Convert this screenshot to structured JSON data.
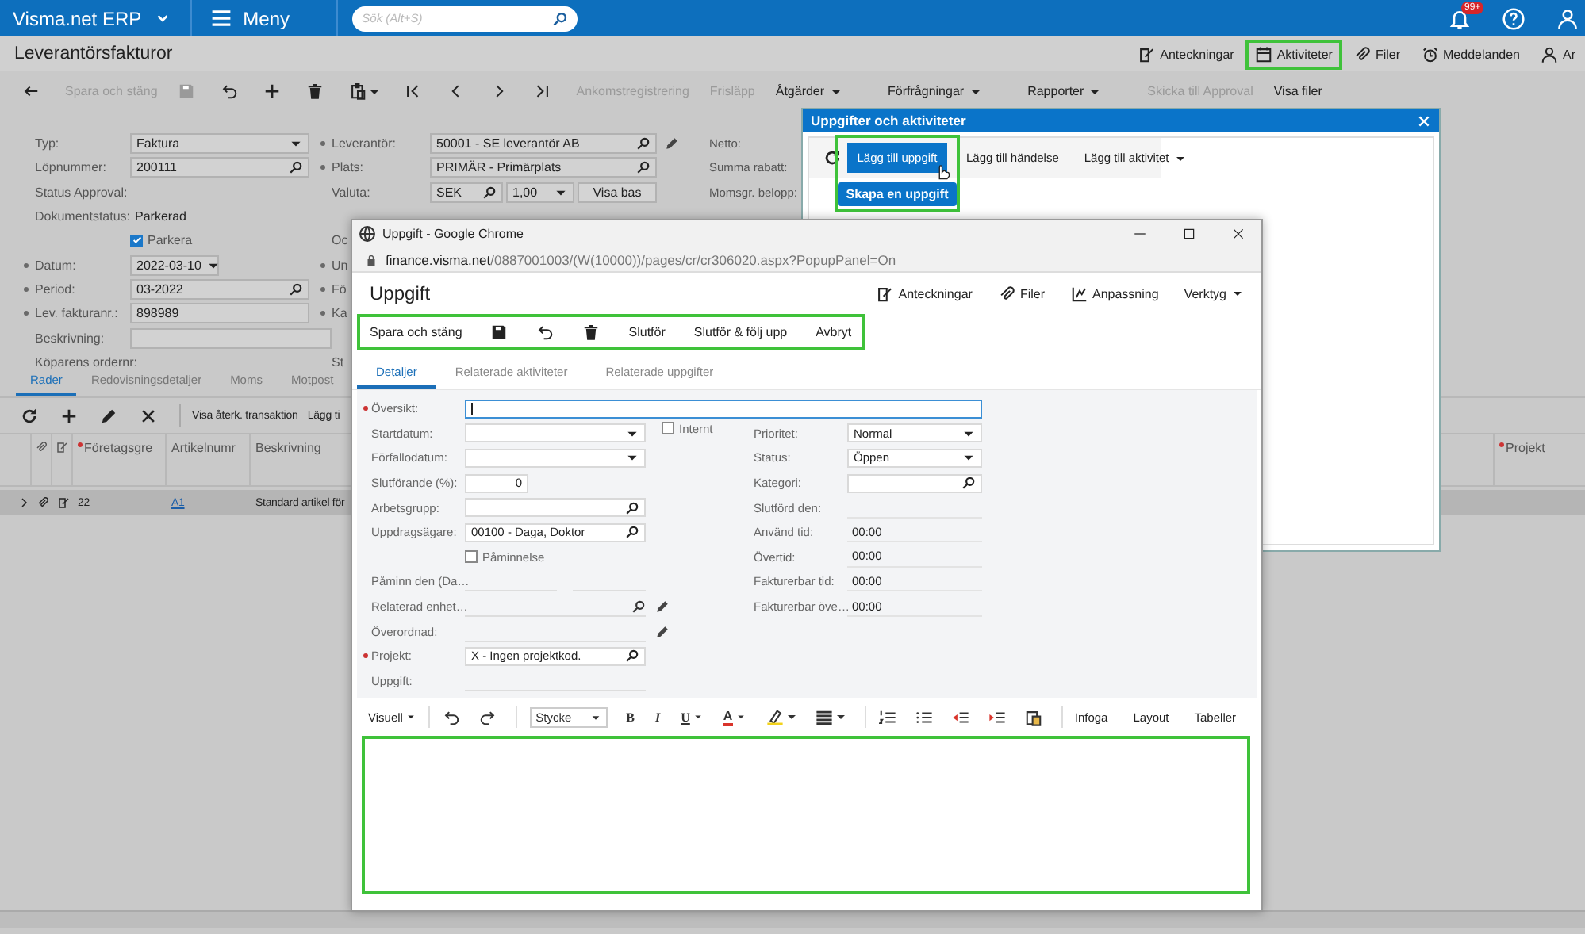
{
  "topbar": {
    "app_name": "Visma.net ERP",
    "menu_label": "Meny",
    "search": {
      "placeholder": "Sök (Alt+S)"
    },
    "notification_badge": "99+"
  },
  "page": {
    "title": "Leverantörsfakturor",
    "header_actions": [
      {
        "label": "Anteckningar",
        "highlighted": false
      },
      {
        "label": "Aktiviteter",
        "highlighted": true
      },
      {
        "label": "Filer",
        "highlighted": false
      },
      {
        "label": "Meddelanden",
        "highlighted": false
      },
      {
        "label": "Ar",
        "highlighted": false
      }
    ]
  },
  "toolbar": {
    "save_and_close": {
      "label": "Spara och stäng",
      "disabled": true
    },
    "save_disabled": true,
    "actions": [
      {
        "label": "Ankomstregistrering",
        "disabled": true,
        "dropdown": false
      },
      {
        "label": "Frisläpp",
        "disabled": true,
        "dropdown": false
      },
      {
        "label": "Åtgärder",
        "disabled": false,
        "dropdown": true
      },
      {
        "label": "Förfrågningar",
        "disabled": false,
        "dropdown": true
      },
      {
        "label": "Rapporter",
        "disabled": false,
        "dropdown": true
      },
      {
        "label": "Skicka till Approval",
        "disabled": true,
        "dropdown": false
      },
      {
        "label": "Visa filer",
        "disabled": false,
        "dropdown": false
      }
    ]
  },
  "form": {
    "rows": [
      {
        "left": {
          "label": "Typ:",
          "required": false,
          "kind": "select",
          "value": "Faktura"
        },
        "mid": {
          "label": "Leverantör:",
          "required": true,
          "kind": "lookup",
          "value": "50001 - SE leverantör AB",
          "editable": true
        },
        "right": {
          "label": "Netto:"
        }
      },
      {
        "left": {
          "label": "Löpnummer:",
          "required": false,
          "kind": "lookup",
          "value": "200111"
        },
        "mid": {
          "label": "Plats:",
          "required": true,
          "kind": "lookup",
          "value": "PRIMÄR - Primärplats",
          "editable": false
        },
        "right": {
          "label": "Summa rabatt:"
        }
      },
      {
        "left": {
          "label": "Status Approval:",
          "required": false,
          "kind": "none"
        },
        "mid": {
          "label": "Valuta:",
          "required": false,
          "kind": "currency",
          "code": "SEK",
          "rate": "1,00",
          "button": "Visa bas",
          "editable": false
        },
        "right": {
          "label": "Momsgr. belopp:"
        }
      },
      {
        "left": {
          "label": "Dokumentstatus:",
          "required": false,
          "kind": "static",
          "value": "Parkerad"
        }
      },
      {
        "left": {
          "kind": "checkbox",
          "label": "Parkera",
          "checked": true
        },
        "mid": {
          "label": "Oc",
          "required": false,
          "kind": "none",
          "editable": false
        }
      },
      {
        "left": {
          "label": "Datum:",
          "required": true,
          "kind": "date",
          "value": "2022-03-10"
        },
        "mid": {
          "label": "Un",
          "required": true,
          "kind": "none",
          "editable": false
        }
      },
      {
        "left": {
          "label": "Period:",
          "required": true,
          "kind": "lookup",
          "value": "03-2022"
        },
        "mid": {
          "label": "Fö",
          "required": true,
          "kind": "none",
          "editable": false
        }
      },
      {
        "left": {
          "label": "Lev. fakturanr.:",
          "required": true,
          "kind": "text",
          "value": "898989"
        },
        "mid": {
          "label": "Ka",
          "required": true,
          "kind": "none",
          "editable": false
        }
      },
      {
        "left": {
          "label": "Beskrivning:",
          "required": false,
          "kind": "wide"
        }
      },
      {
        "left": {
          "label": "Köparens ordernr:",
          "required": false,
          "kind": "none"
        },
        "mid": {
          "label": "St",
          "required": false,
          "kind": "none",
          "editable": false
        }
      }
    ]
  },
  "detail_tabs": [
    {
      "label": "Rader",
      "selected": true
    },
    {
      "label": "Redovisningsdetaljer",
      "selected": false
    },
    {
      "label": "Moms",
      "selected": false
    },
    {
      "label": "Motpost",
      "selected": false
    }
  ],
  "grid": {
    "toolbar": [
      "Visa återk. transaktion",
      "Lägg ti"
    ],
    "columns": [
      {
        "label": "Företagsgre",
        "required": true
      },
      {
        "label": "Artikelnumr",
        "required": false
      },
      {
        "label": "Beskrivning",
        "required": false
      }
    ],
    "far_right_column": {
      "label": "Projekt",
      "required": true
    },
    "rows": [
      {
        "selected": true,
        "cells": [
          {
            "text": "22",
            "kind": "text"
          },
          {
            "text": "A1",
            "kind": "link"
          },
          {
            "text": "Standard artikel för",
            "kind": "text"
          }
        ]
      }
    ]
  },
  "activities_popup": {
    "title": "Uppgifter och aktiviteter",
    "highlighted": true,
    "tooltip": "Skapa en uppgift",
    "buttons": [
      {
        "label": "Lägg till uppgift",
        "kind": "primary"
      },
      {
        "label": "Lägg till händelse",
        "kind": "plain"
      },
      {
        "label": "Lägg till aktivitet",
        "kind": "dropdown"
      }
    ]
  },
  "browser_window": {
    "title": "Uppgift - Google Chrome",
    "url_host": "finance.visma.net",
    "url_path": "/0887001003/(W(10000))/pages/cr/cr306020.aspx?PopupPanel=On",
    "page_title": "Uppgift",
    "header_actions": [
      {
        "label": "Anteckningar",
        "dropdown": false
      },
      {
        "label": "Filer",
        "dropdown": false
      },
      {
        "label": "Anpassning",
        "dropdown": false
      },
      {
        "label": "Verktyg",
        "dropdown": true
      }
    ],
    "toolbar": {
      "highlighted": true,
      "items": [
        "Spara och stäng",
        "Slutför",
        "Slutför & följ upp",
        "Avbryt"
      ]
    },
    "tabs": [
      {
        "label": "Detaljer",
        "selected": true
      },
      {
        "label": "Relaterade aktiviteter",
        "selected": false
      },
      {
        "label": "Relaterade uppgifter",
        "selected": false
      }
    ],
    "overview": {
      "label": "Översikt:",
      "required": true,
      "focused": true
    },
    "rows": [
      {
        "left": {
          "label": "Startdatum:",
          "required": false,
          "kind": "date"
        },
        "extra": {
          "kind": "checkbox",
          "label": "Internt",
          "checked": false
        },
        "right": {
          "label": "Prioritet:",
          "kind": "select",
          "value": "Normal"
        }
      },
      {
        "left": {
          "label": "Förfallodatum:",
          "required": false,
          "kind": "date"
        },
        "right": {
          "label": "Status:",
          "kind": "select",
          "value": "Öppen"
        }
      },
      {
        "left": {
          "label": "Slutförande (%):",
          "required": false,
          "kind": "number",
          "value": "0"
        },
        "right": {
          "label": "Kategori:",
          "kind": "lookup"
        }
      },
      {
        "left": {
          "label": "Arbetsgrupp:",
          "required": false,
          "kind": "lookup"
        },
        "right": {
          "label": "Slutförd den:",
          "kind": "static"
        }
      },
      {
        "left": {
          "label": "Uppdragsägare:",
          "required": false,
          "kind": "lookup",
          "value": "00100 - Daga, Doktor"
        },
        "right": {
          "label": "Använd tid:",
          "kind": "static",
          "value": "00:00"
        }
      },
      {
        "left": {
          "kind": "checkbox",
          "label": "Påminnelse",
          "checked": false
        },
        "right": {
          "label": "Övertid:",
          "kind": "static",
          "value": "00:00"
        }
      },
      {
        "left": {
          "label": "Påminn den (Da…",
          "required": false,
          "kind": "split"
        },
        "right": {
          "label": "Fakturerbar tid:",
          "kind": "static",
          "value": "00:00"
        }
      },
      {
        "left": {
          "label": "Relaterad enhet…",
          "required": false,
          "kind": "readonly_lookup"
        },
        "extra": {
          "kind": "edit"
        },
        "right": {
          "label": "Fakturerbar öve…",
          "kind": "static",
          "value": "00:00"
        }
      },
      {
        "left": {
          "label": "Överordnad:",
          "required": false,
          "kind": "readonly"
        },
        "extra": {
          "kind": "edit"
        }
      },
      {
        "left": {
          "label": "Projekt:",
          "required": true,
          "kind": "lookup",
          "value": "X - Ingen projektkod."
        }
      },
      {
        "left": {
          "label": "Uppgift:",
          "required": false,
          "kind": "readonly"
        }
      }
    ],
    "editor": {
      "highlighted": true,
      "mode_menu": "Visuell",
      "format_select": "Stycke",
      "glyphs": [
        "B",
        "I",
        "U",
        "A"
      ],
      "text_buttons": [
        "Infoga",
        "Layout",
        "Tabeller"
      ]
    }
  }
}
